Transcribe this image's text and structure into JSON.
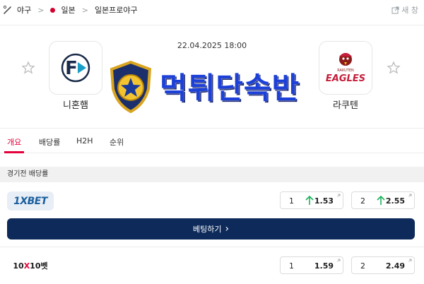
{
  "breadcrumb": {
    "items": [
      {
        "label": "야구",
        "icon": "baseball-bat-icon"
      },
      {
        "label": "일본",
        "icon": "japan-flag-icon"
      },
      {
        "label": "일본프로야구"
      }
    ],
    "open_new_label": "새 창"
  },
  "match": {
    "date": "22.04.2025 18:00",
    "home": {
      "name": "니혼햄",
      "logo_text": "F",
      "favorite": false
    },
    "away": {
      "name": "라쿠텐",
      "logo_text": "EAGLES",
      "logo_subtext": "RAKUTEN",
      "favorite": false
    }
  },
  "watermark": {
    "text": "먹튀단속반"
  },
  "tabs": [
    {
      "label": "개요",
      "active": true
    },
    {
      "label": "배당률",
      "active": false
    },
    {
      "label": "H2H",
      "active": false
    },
    {
      "label": "순위",
      "active": false
    }
  ],
  "odds_section": {
    "title": "경기전 배당률",
    "bookmakers": [
      {
        "name": "1XBET",
        "odds": [
          {
            "label": "1",
            "value": "1.53",
            "trend": "up"
          },
          {
            "label": "2",
            "value": "2.55",
            "trend": "up"
          }
        ]
      },
      {
        "name": "10X10벳",
        "name_parts": {
          "a": "10",
          "x": "X",
          "b": "10",
          "c": "벳"
        },
        "odds": [
          {
            "label": "1",
            "value": "1.59",
            "trend": "none"
          },
          {
            "label": "2",
            "value": "2.49",
            "trend": "none"
          }
        ]
      }
    ],
    "bet_button_label": "베팅하기"
  },
  "colors": {
    "accent": "#e4003a",
    "button_bg": "#0d2a5a",
    "trend_up": "#19b35a",
    "watermark": "#1c40d8"
  }
}
